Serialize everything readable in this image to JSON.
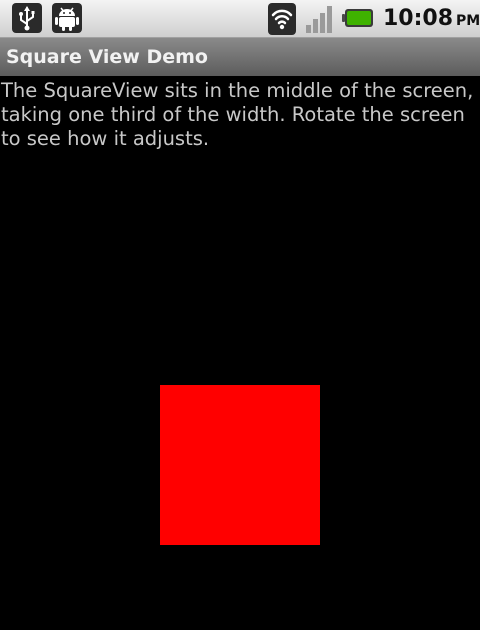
{
  "status_bar": {
    "time": "10:08",
    "ampm": "PM",
    "icons": [
      "usb-icon",
      "android-debug-icon",
      "wifi-icon",
      "signal-icon",
      "battery-icon"
    ],
    "battery_color": "#3fb200"
  },
  "title_bar": {
    "title": "Square View Demo"
  },
  "content": {
    "description": "The SquareView sits in the middle of the screen, taking one third of the width. Rotate the screen to see how it adjusts.",
    "square_color": "#ff0000"
  }
}
